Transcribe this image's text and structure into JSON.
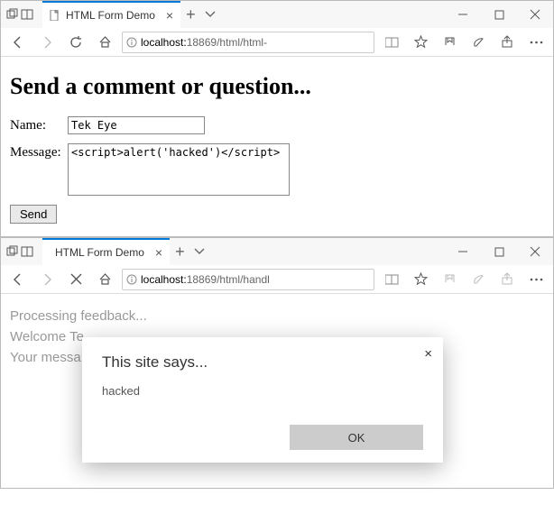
{
  "window1": {
    "tab_title": "HTML Form Demo",
    "url_prefix": "localhost:",
    "url_port": "18869",
    "url_path": "/html/html-"
  },
  "form": {
    "heading": "Send a comment or question...",
    "name_label": "Name:",
    "name_value": "Tek Eye",
    "message_label": "Message:",
    "message_value": "<script>alert('hacked')</script>",
    "send_label": "Send"
  },
  "window2": {
    "tab_title": "HTML Form Demo",
    "url_prefix": "localhost:",
    "url_port": "18869",
    "url_path": "/html/handl"
  },
  "result": {
    "line1": "Processing feedback...",
    "line2": "Welcome Te",
    "line3": "Your messa"
  },
  "dialog": {
    "title": "This site says...",
    "message": "hacked",
    "ok_label": "OK"
  }
}
